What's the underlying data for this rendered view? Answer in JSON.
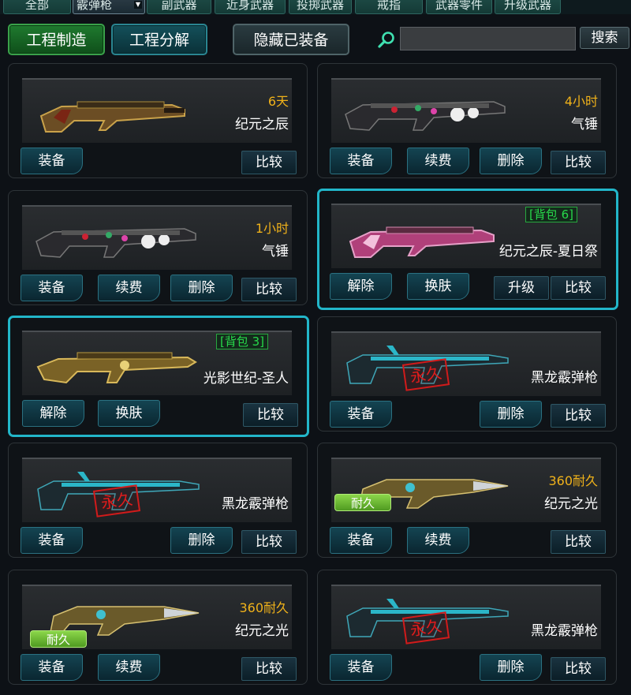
{
  "tabs": [
    {
      "label": "全部"
    },
    {
      "label": "霰弹枪",
      "selected": true
    },
    {
      "label": "副武器"
    },
    {
      "label": "近身武器"
    },
    {
      "label": "投掷武器"
    },
    {
      "label": "戒指"
    },
    {
      "label": "武器零件"
    },
    {
      "label": "升级武器"
    }
  ],
  "toolbar": {
    "make_label": "工程制造",
    "split_label": "工程分解",
    "hide_label": "隐藏已装备",
    "search_value": "",
    "search_label": "搜索",
    "search_icon": "search-icon"
  },
  "colors": {
    "highlight_border": "#22b6c9",
    "timer": "#f0b21a",
    "backpack_tag": "#27d84a",
    "durable_badge": "#6fbf33",
    "permanent_stamp": "#d11b1b"
  },
  "items": [
    {
      "name": "纪元之辰",
      "timer": "6天",
      "actions": [
        "装备"
      ],
      "compare": "比较"
    },
    {
      "name": "气锤",
      "timer": "4小时",
      "actions": [
        "装备",
        "续费",
        "删除"
      ],
      "compare": "比较"
    },
    {
      "name": "气锤",
      "timer": "1小时",
      "actions": [
        "装备",
        "续费",
        "删除"
      ],
      "compare": "比较"
    },
    {
      "name": "纪元之辰-夏日祭",
      "backpack": "[背包 6]",
      "highlighted": true,
      "actions": [
        "解除",
        "换肤"
      ],
      "upgrade": "升级",
      "compare": "比较"
    },
    {
      "name": "光影世纪-圣人",
      "backpack": "[背包 3]",
      "highlighted": true,
      "actions": [
        "解除",
        "换肤"
      ],
      "compare": "比较"
    },
    {
      "name": "黑龙霰弹枪",
      "stamp": "永久",
      "actions": [
        "装备",
        "",
        "删除"
      ],
      "compare": "比较"
    },
    {
      "name": "黑龙霰弹枪",
      "stamp": "永久",
      "actions": [
        "装备",
        "",
        "删除"
      ],
      "compare": "比较"
    },
    {
      "name": "纪元之光",
      "timer": "360耐久",
      "durable": "耐久",
      "actions": [
        "装备",
        "续费"
      ],
      "compare": "比较"
    },
    {
      "name": "纪元之光",
      "timer": "360耐久",
      "durable": "耐久",
      "actions": [
        "装备",
        "续费"
      ],
      "compare": "比较"
    },
    {
      "name": "黑龙霰弹枪",
      "stamp": "永久",
      "actions": [
        "装备",
        "",
        "删除"
      ],
      "compare": "比较"
    }
  ]
}
